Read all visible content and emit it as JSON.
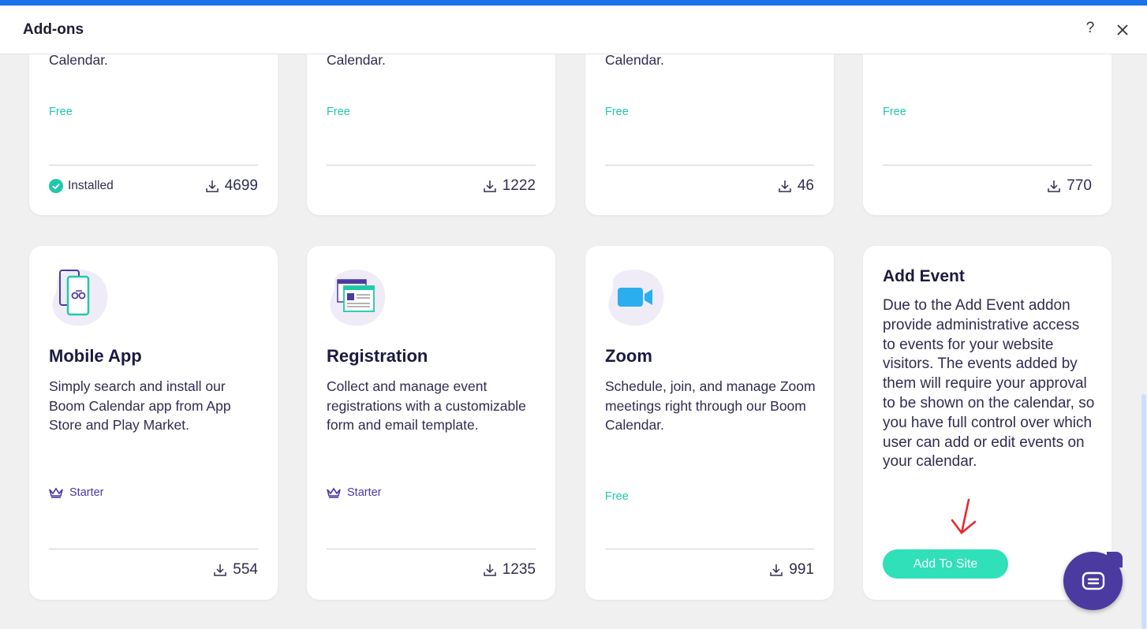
{
  "header": {
    "title": "Add-ons",
    "help": "?"
  },
  "top_row": [
    {
      "desc": "Calendar.",
      "price": "Free",
      "installed_label": "Installed",
      "downloads": "4699"
    },
    {
      "desc": "Calendar.",
      "price": "Free",
      "downloads": "1222"
    },
    {
      "desc": "Calendar.",
      "price": "Free",
      "downloads": "46"
    },
    {
      "price": "Free",
      "downloads": "770"
    }
  ],
  "cards": [
    {
      "name": "Mobile App",
      "desc": "Simply search and install our Boom Calendar app from App Store and Play Market.",
      "plan": "Starter",
      "downloads": "554"
    },
    {
      "name": "Registration",
      "desc": "Collect and manage event registrations with a customizable form and email template.",
      "plan": "Starter",
      "downloads": "1235"
    },
    {
      "name": "Zoom",
      "desc": "Schedule, join, and manage Zoom meetings right through our Boom Calendar.",
      "price": "Free",
      "downloads": "991"
    },
    {
      "name": "Add Event",
      "desc": "Due to the Add Event addon provide administrative access to events for your website visitors. The events added by them will require your approval to be shown on the calendar, so you have full control over which user can add or edit events on your calendar.",
      "button": "Add To Site"
    }
  ],
  "colors": {
    "accent_bar": "#1a73e8",
    "free": "#1ec9a8",
    "plan": "#4a3aa8",
    "button": "#2fe0b8",
    "chat": "#4b3aa0"
  }
}
